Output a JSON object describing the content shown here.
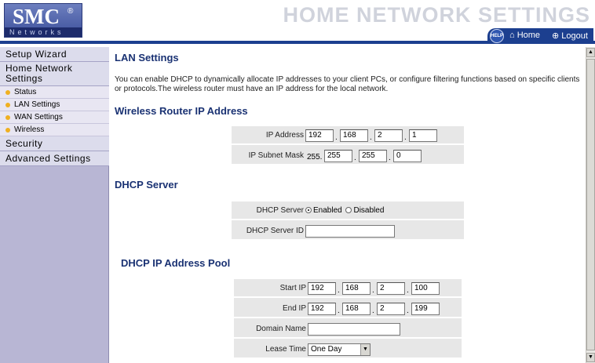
{
  "header": {
    "brand": "SMC",
    "brand_reg": "®",
    "brand_sub": "Networks",
    "banner": "HOME NETWORK SETTINGS",
    "help_label": "HELP",
    "home_label": "Home",
    "logout_label": "Logout"
  },
  "sidebar": {
    "items": [
      {
        "label": "Setup Wizard"
      },
      {
        "label": "Home Network Settings",
        "sub": [
          "Status",
          "LAN Settings",
          "WAN Settings",
          "Wireless"
        ]
      },
      {
        "label": "Security"
      },
      {
        "label": "Advanced Settings"
      }
    ]
  },
  "main": {
    "title": "LAN Settings",
    "intro": "You can enable DHCP to dynamically allocate IP addresses to your client PCs, or configure filtering functions based on specific clients or protocols.The wireless router must have an IP address for the local network.",
    "router_ip": {
      "heading": "Wireless Router IP Address",
      "ip_label": "IP Address",
      "ip": [
        "192",
        "168",
        "2",
        "1"
      ],
      "mask_label": "IP Subnet Mask",
      "mask_prefix": "255.",
      "mask": [
        "255",
        "255",
        "0"
      ]
    },
    "dhcp": {
      "heading": "DHCP Server",
      "server_label": "DHCP Server",
      "enabled_label": "Enabled",
      "disabled_label": "Disabled",
      "selected": "Enabled",
      "server_id_label": "DHCP Server ID",
      "server_id_value": ""
    },
    "pool": {
      "heading": "DHCP IP Address Pool",
      "start_label": "Start IP",
      "start": [
        "192",
        "168",
        "2",
        "100"
      ],
      "end_label": "End IP",
      "end": [
        "192",
        "168",
        "2",
        "199"
      ],
      "domain_label": "Domain Name",
      "domain_value": "",
      "lease_label": "Lease Time",
      "lease_value": "One Day"
    }
  }
}
